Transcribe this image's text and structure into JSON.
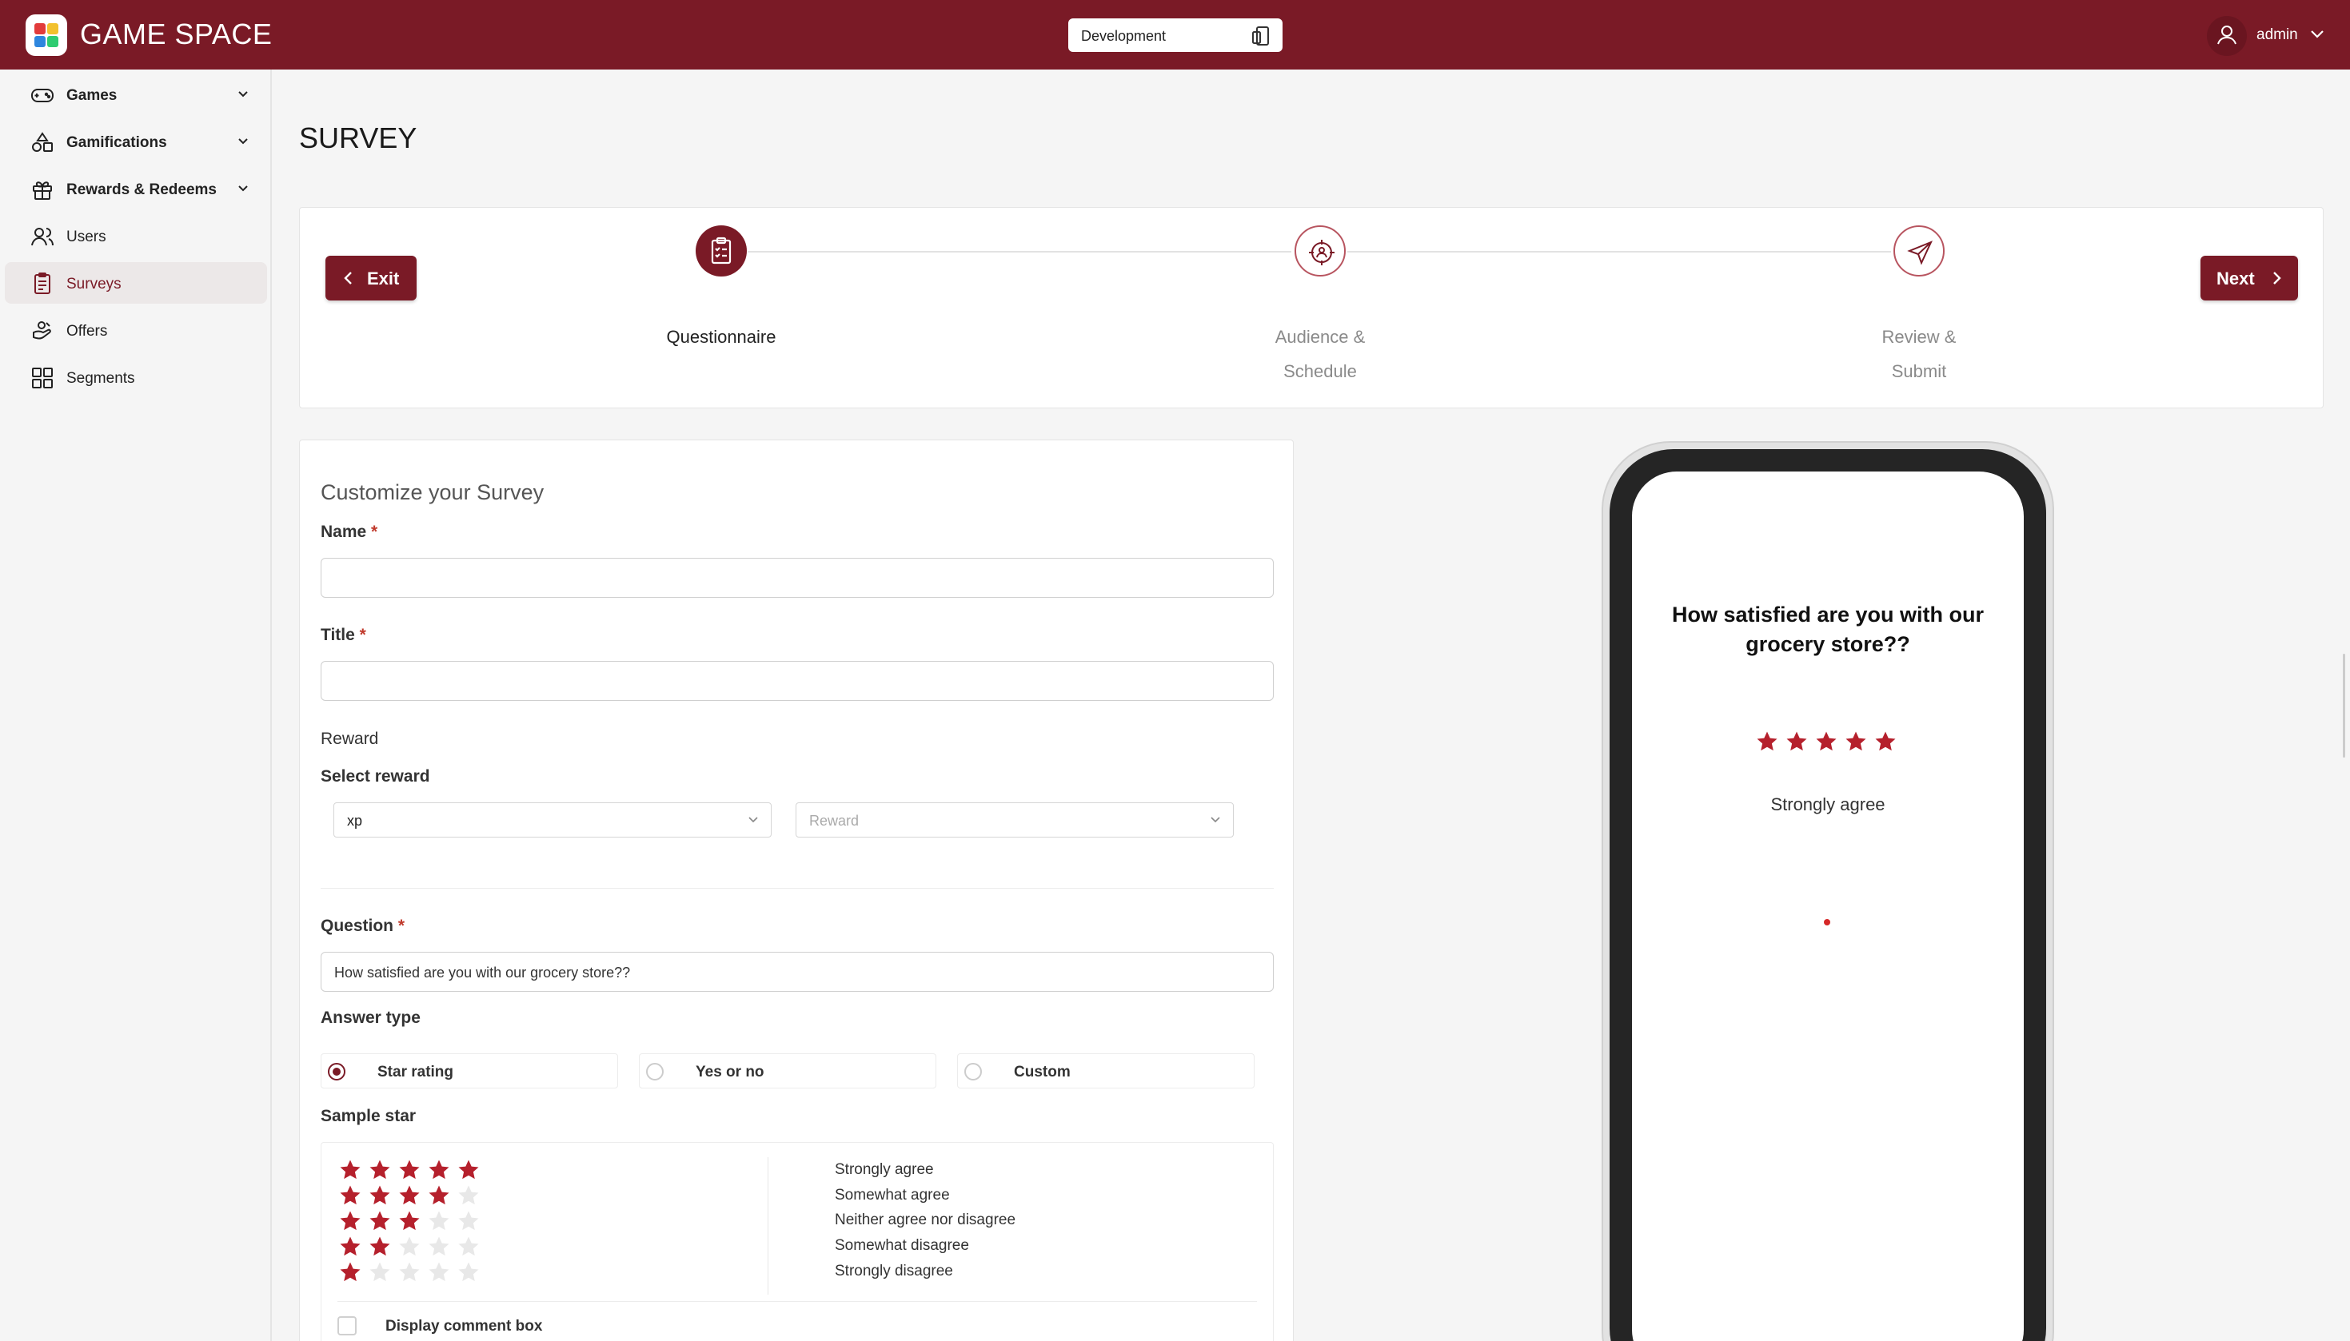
{
  "header": {
    "brand": "GAME SPACE",
    "environment": "Development",
    "user": "admin"
  },
  "sidebar": {
    "items": [
      {
        "label": "Games",
        "icon": "gamepad-icon",
        "expandable": true
      },
      {
        "label": "Gamifications",
        "icon": "shapes-icon",
        "expandable": true
      },
      {
        "label": "Rewards & Redeems",
        "icon": "gift-icon",
        "expandable": true
      },
      {
        "label": "Users",
        "icon": "users-icon",
        "expandable": false
      },
      {
        "label": "Surveys",
        "icon": "clipboard-icon",
        "expandable": false,
        "active": true
      },
      {
        "label": "Offers",
        "icon": "offers-icon",
        "expandable": false
      },
      {
        "label": "Segments",
        "icon": "grid-icon",
        "expandable": false
      }
    ]
  },
  "page": {
    "title": "SURVEY"
  },
  "stepper": {
    "exit_label": "Exit",
    "next_label": "Next",
    "steps": [
      {
        "line1": "Questionnaire",
        "line2": "",
        "state": "current"
      },
      {
        "line1": "Audience &",
        "line2": "Schedule",
        "state": "pending"
      },
      {
        "line1": "Review &",
        "line2": "Submit",
        "state": "pending"
      }
    ]
  },
  "form": {
    "heading": "Customize your Survey",
    "name_label": "Name",
    "name_value": "",
    "title_label": "Title",
    "title_value": "",
    "reward_label": "Reward",
    "select_reward_label": "Select reward",
    "reward_type_value": "xp",
    "reward_placeholder": "Reward",
    "question_label": "Question",
    "question_value": "How satisfied are you with our grocery store??",
    "answer_type_label": "Answer type",
    "answer_types": [
      {
        "label": "Star rating",
        "selected": true
      },
      {
        "label": "Yes or no",
        "selected": false
      },
      {
        "label": "Custom",
        "selected": false
      }
    ],
    "sample_star_label": "Sample star",
    "sample_scale": [
      {
        "stars": 5,
        "label": "Strongly agree"
      },
      {
        "stars": 4,
        "label": "Somewhat agree"
      },
      {
        "stars": 3,
        "label": "Neither agree nor disagree"
      },
      {
        "stars": 2,
        "label": "Somewhat disagree"
      },
      {
        "stars": 1,
        "label": "Strongly disagree"
      }
    ],
    "comment_box_label": "Display comment box",
    "comment_box_checked": false
  },
  "preview": {
    "question": "How satisfied are you with our grocery store??",
    "stars": 5,
    "label": "Strongly agree"
  },
  "colors": {
    "brand": "#7a1a26",
    "star_on": "#b5202c",
    "star_off": "#e8e8e8"
  }
}
